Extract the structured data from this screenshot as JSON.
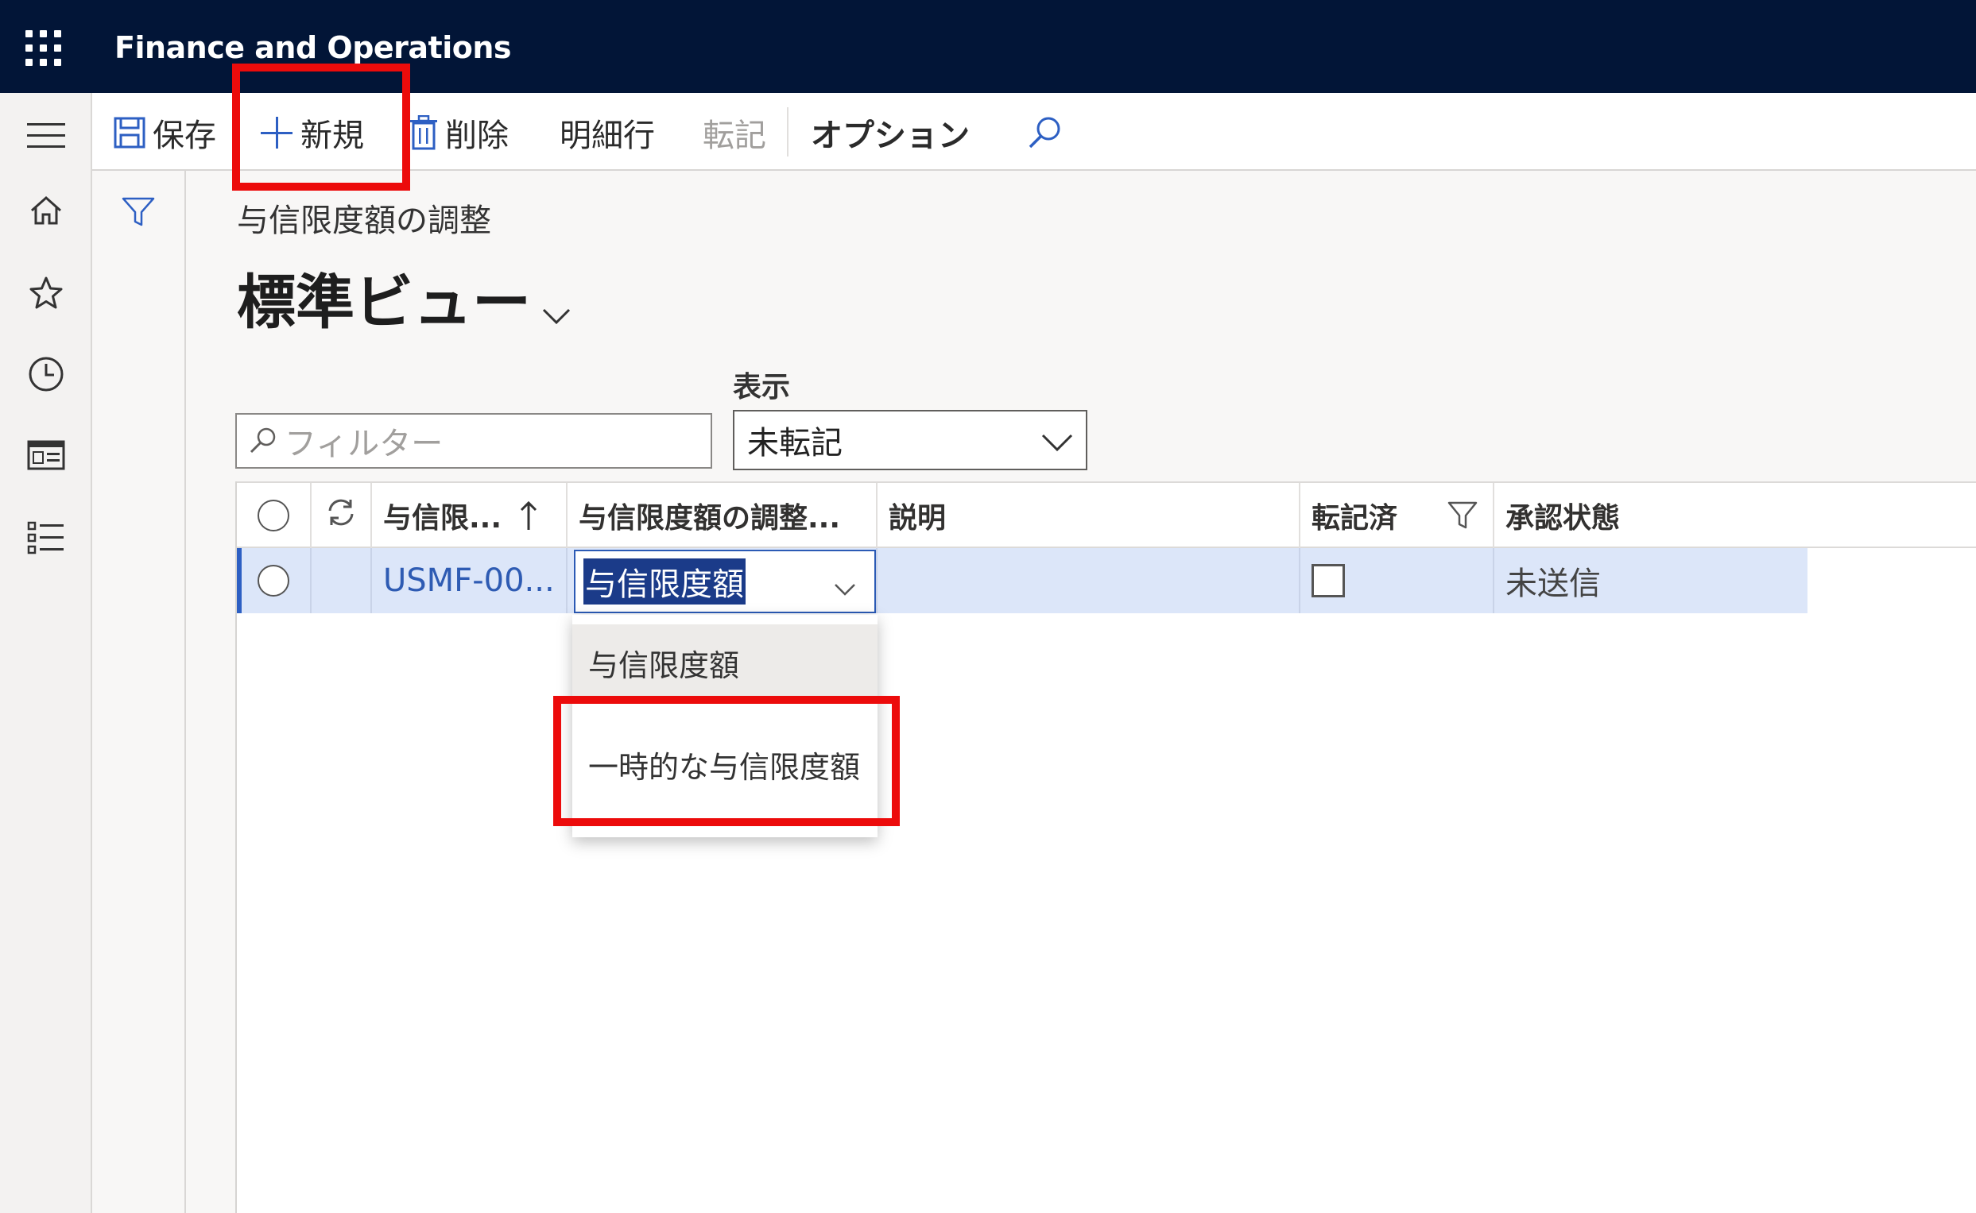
{
  "app": {
    "title": "Finance and Operations"
  },
  "toolbar": {
    "save_label": "保存",
    "new_label": "新規",
    "delete_label": "削除",
    "lines_label": "明細行",
    "post_label": "転記",
    "options_label": "オプション"
  },
  "page": {
    "breadcrumb": "与信限度額の調整",
    "view_name": "標準ビュー"
  },
  "filter": {
    "placeholder": "フィルター"
  },
  "show": {
    "label": "表示",
    "selected": "未転記"
  },
  "grid": {
    "columns": [
      "与信限...",
      "与信限度額の調整...",
      "説明",
      "転記済",
      "承認状態"
    ],
    "rows": [
      {
        "id": "USMF-00...",
        "type": "与信限度額",
        "description": "",
        "posted": false,
        "status": "未送信"
      }
    ]
  },
  "dropdown": {
    "options": [
      "与信限度額",
      "一時的な与信限度額"
    ]
  },
  "colors": {
    "topbar": "#021537",
    "accent": "#2d5fc3",
    "highlight": "#ec0b0b",
    "selected_row": "#dce6f9"
  }
}
